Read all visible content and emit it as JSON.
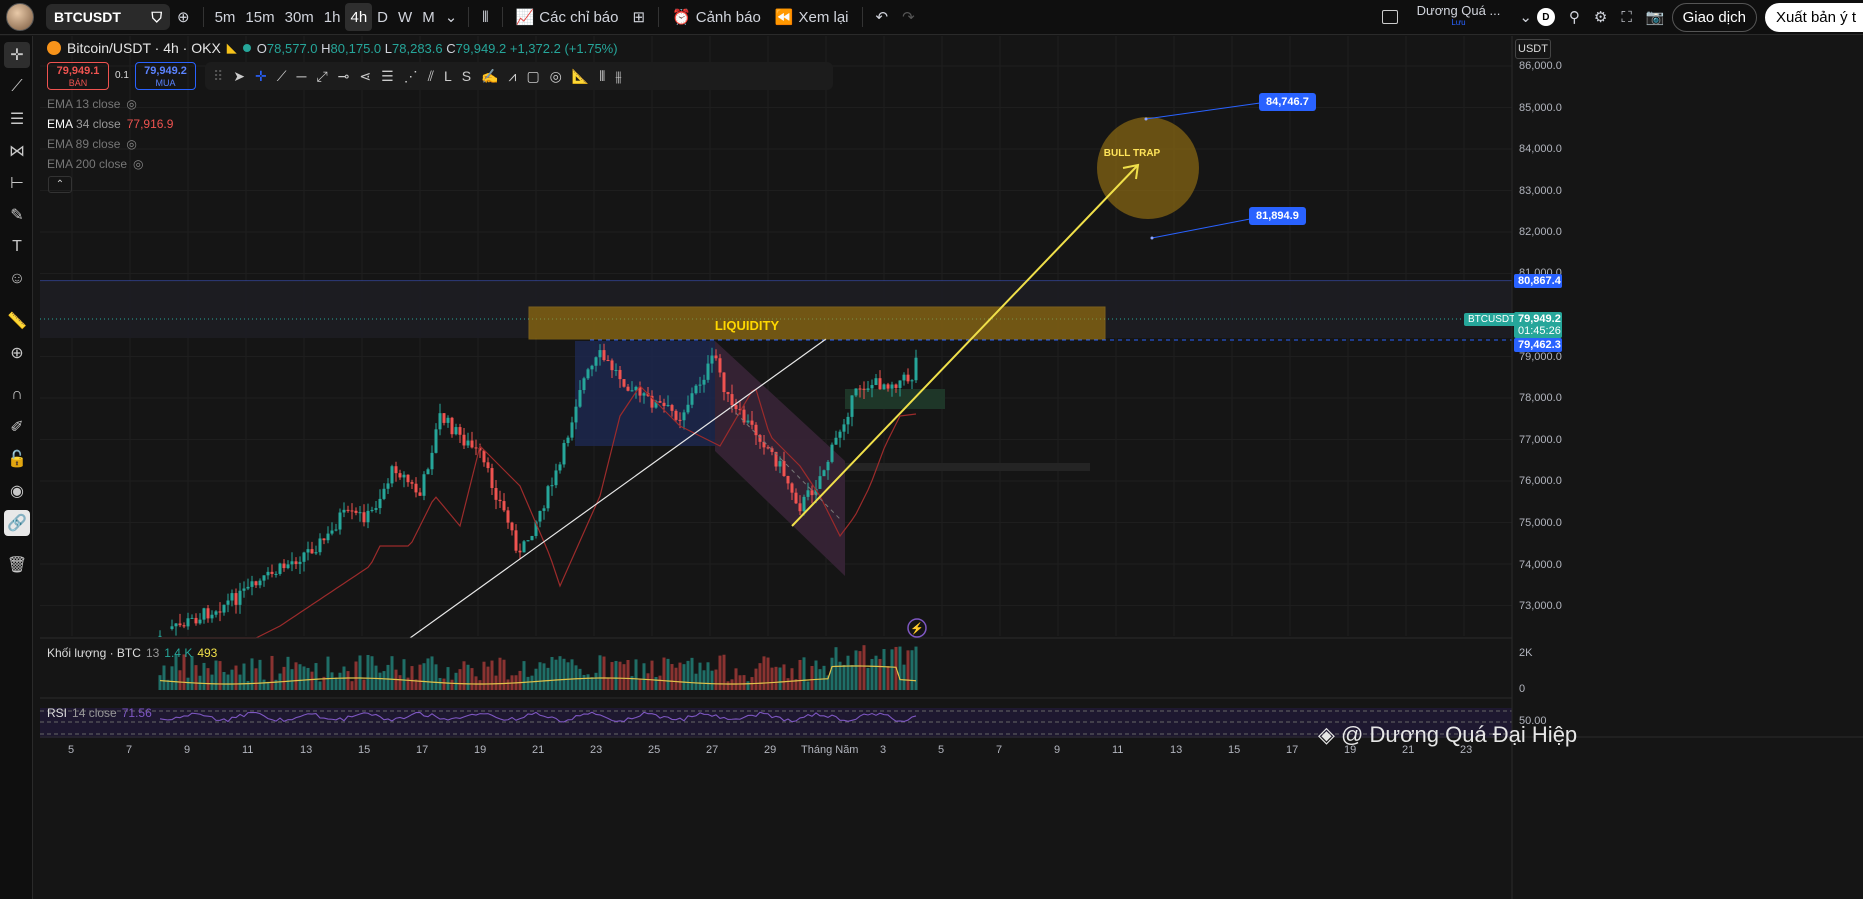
{
  "topbar": {
    "symbol": "BTCUSDT",
    "timeframes": [
      "5m",
      "15m",
      "30m",
      "1h",
      "4h",
      "D",
      "W",
      "M"
    ],
    "active_tf": "4h",
    "indicators": "Các chỉ báo",
    "alerts": "Cảnh báo",
    "replay": "Xem lại",
    "layout_name": "Dương Quá ...",
    "layout_sub": "Lưu",
    "layout_badge": "D",
    "trade": "Giao dịch",
    "publish": "Xuất bản ý t"
  },
  "legend": {
    "title": "Bitcoin/USDT · 4h · OKX",
    "o_label": "O",
    "o": "78,577.0",
    "h_label": "H",
    "h": "80,175.0",
    "l_label": "L",
    "l": "78,283.6",
    "c_label": "C",
    "c": "79,949.2",
    "change": "+1,372.2 (+1.75%)",
    "sell_price": "79,949.1",
    "sell_label": "BÁN",
    "spread": "0.1",
    "buy_price": "79,949.2",
    "buy_label": "MUA"
  },
  "emas": [
    {
      "name": "EMA 13 close",
      "value": "",
      "on": false
    },
    {
      "name": "EMA",
      "name2": "34 close",
      "value": "77,916.9",
      "on": true
    },
    {
      "name": "EMA 89 close",
      "value": "",
      "on": false
    },
    {
      "name": "EMA 200 close",
      "value": "",
      "on": false
    }
  ],
  "price_axis": {
    "currency": "USDT",
    "labels": [
      "86,000.0",
      "85,000.0",
      "84,000.0",
      "83,000.0",
      "82,000.0",
      "81,000.0",
      "79,000.0",
      "78,000.0",
      "77,000.0",
      "76,000.0",
      "75,000.0",
      "74,000.0",
      "73,000.0"
    ],
    "line_tag": "80,867.4",
    "symbol_tag": "BTCUSDT",
    "last_price": "79,949.2",
    "countdown": "01:45:26",
    "dash_tag": "79,462.3"
  },
  "time_axis": [
    "5",
    "7",
    "9",
    "11",
    "13",
    "15",
    "17",
    "19",
    "21",
    "23",
    "25",
    "27",
    "29",
    "Tháng Năm",
    "3",
    "5",
    "7",
    "9",
    "11",
    "13",
    "15",
    "17",
    "19",
    "21",
    "23"
  ],
  "annotations": {
    "liquidity": "LIQUIDITY",
    "bull_trap": "BULL TRAP",
    "target1": "84,746.7",
    "target2": "81,894.9"
  },
  "volume": {
    "label": "Khối lượng · BTC",
    "n": "13",
    "v1": "1.4 K",
    "v2": "493",
    "axis_top": "2K",
    "axis_zero": "0"
  },
  "rsi": {
    "label": "RSI",
    "params": "14 close",
    "value": "71.56",
    "axis": "50.00"
  },
  "watermark": "@ Dương Quá Đại Hiệp",
  "colors": {
    "up": "#26a69a",
    "down": "#ef5350",
    "accent": "#2962ff",
    "liquidity": "#b8860b",
    "arrow": "#f0e04a"
  }
}
